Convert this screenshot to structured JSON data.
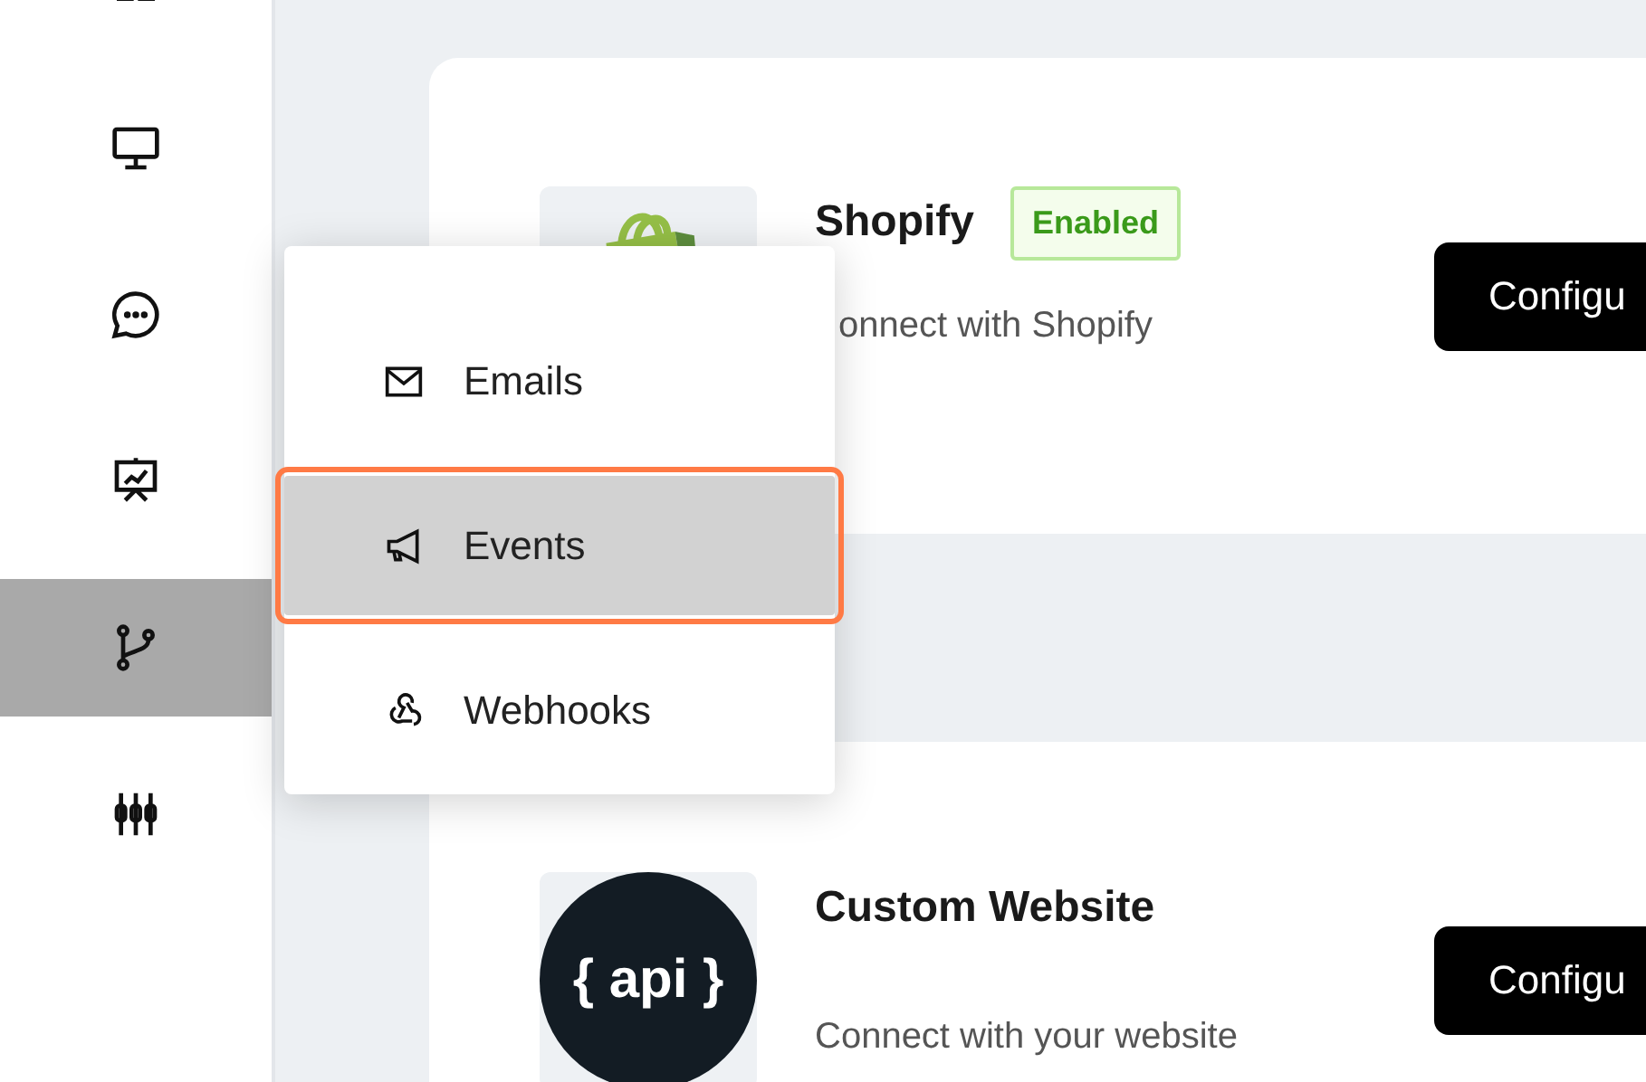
{
  "sidebar": {
    "items": [
      {
        "selected": false
      },
      {
        "selected": false
      },
      {
        "selected": false
      },
      {
        "selected": false
      },
      {
        "selected": true
      },
      {
        "selected": false
      }
    ]
  },
  "integrations": [
    {
      "kind": "shopify",
      "name": "Shopify",
      "status": "Enabled",
      "description": "onnect with Shopify",
      "button": "Configu"
    },
    {
      "kind": "api",
      "logo_text": "{ api }",
      "name": "Custom Website",
      "description": "Connect with your website",
      "button": "Configu"
    }
  ],
  "menu": {
    "items": [
      {
        "label": "Emails",
        "selected": false
      },
      {
        "label": "Events",
        "selected": true
      },
      {
        "label": "Webhooks",
        "selected": false
      }
    ]
  }
}
